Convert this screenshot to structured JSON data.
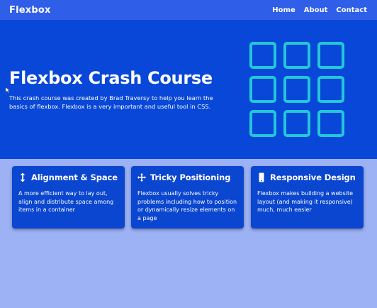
{
  "navbar": {
    "brand": "Flexbox",
    "links": [
      "Home",
      "About",
      "Contact"
    ]
  },
  "hero": {
    "title": "Flexbox Crash Course",
    "text": "This crash course was created by Brad Traversy to help you learn the basics of flexbox. Flexbox is a very important and useful tool in CSS.",
    "logo_icon": "grid-3x3-icon"
  },
  "cards": [
    {
      "icon": "vertical-arrows-icon",
      "title": "Alignment & Space",
      "text": "A more efficient way to lay out, align and distribute space among items in a container"
    },
    {
      "icon": "move-arrows-icon",
      "title": "Tricky Positioning",
      "text": "Flexbox usually solves tricky problems including how to position or dynamically resize elements on a page"
    },
    {
      "icon": "mobile-phone-icon",
      "title": "Responsive Design",
      "text": "Flexbox makes building a website layout (and making it responsive) much, much easier"
    }
  ],
  "colors": {
    "navbar": "#2f5ee8",
    "hero": "#0847d8",
    "page_background": "#9db2f5",
    "card": "#0a46cf",
    "logo_accent": "#23c7d8"
  }
}
